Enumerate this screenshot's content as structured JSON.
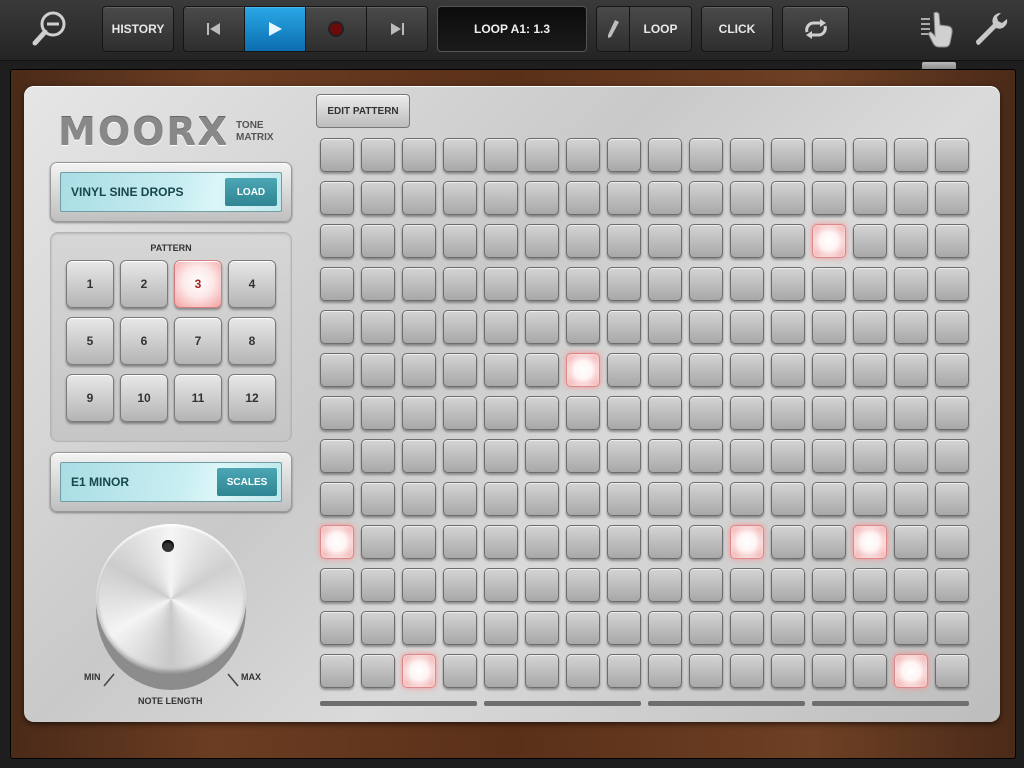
{
  "toolbar": {
    "history_label": "HISTORY",
    "loop_position": "LOOP A1: 1.3",
    "loop_label": "LOOP",
    "click_label": "CLICK",
    "accent_color": "#1a8fd4",
    "icons": {
      "zoom": "zoom-out-icon",
      "previous": "skip-back-icon",
      "play": "play-icon",
      "record": "record-icon",
      "next": "skip-forward-icon",
      "pencil": "pencil-icon",
      "cycle": "cycle-icon",
      "hand": "hand-pointer-icon",
      "settings": "wrench-icon"
    }
  },
  "device": {
    "logo": "MOORX",
    "logo_subtitle_1": "TONE",
    "logo_subtitle_2": "MATRIX",
    "preset": {
      "name": "VINYL SINE DROPS",
      "button_label": "LOAD"
    },
    "pattern_title": "PATTERN",
    "patterns": [
      "1",
      "2",
      "3",
      "4",
      "5",
      "6",
      "7",
      "8",
      "9",
      "10",
      "11",
      "12"
    ],
    "active_pattern": "3",
    "scale": {
      "name": "E1 MINOR",
      "button_label": "SCALES"
    },
    "knob": {
      "label": "NOTE LENGTH",
      "min_label": "MIN",
      "max_label": "MAX"
    },
    "edit_pattern_label": "EDIT PATTERN",
    "grid": {
      "rows": 13,
      "cols": 16,
      "active_cells": [
        [
          2,
          12
        ],
        [
          5,
          6
        ],
        [
          9,
          0
        ],
        [
          9,
          10
        ],
        [
          9,
          13
        ],
        [
          12,
          2
        ],
        [
          12,
          14
        ]
      ],
      "active_color": "#f4a0a0"
    }
  }
}
